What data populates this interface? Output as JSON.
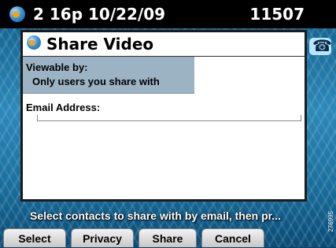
{
  "status_bar": {
    "time": "2 16p 10/22/09",
    "extension": "11507",
    "globe_icon": "globe-icon",
    "phone_icon": "phone-icon"
  },
  "window": {
    "title": "Share Video",
    "viewable_by_label": "Viewable by:",
    "viewable_by_value": "Only users you share with",
    "email_label": "Email Address:",
    "email_value": ""
  },
  "prompt": "Select contacts to share with by email, then pr...",
  "softkeys": [
    "Select",
    "Privacy",
    "Share",
    "Cancel"
  ],
  "watermark": "276995",
  "colors": {
    "status_bar": "#000000",
    "viewable_box": "#9cb3c4",
    "softkey": "#d8d8d8"
  }
}
